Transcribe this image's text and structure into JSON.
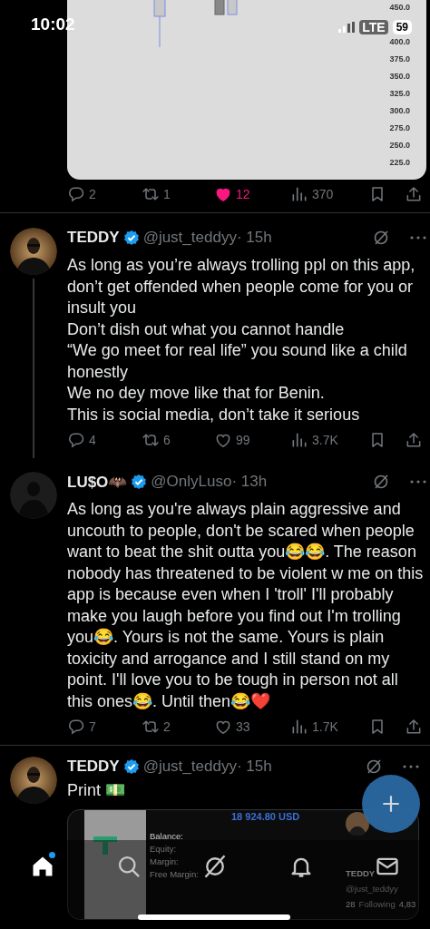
{
  "status_bar": {
    "time": "10:02",
    "network": "LTE",
    "battery": "59"
  },
  "tweets": [
    {
      "media": {
        "kind": "chart",
        "axis_labels": [
          "450.0",
          "400.0",
          "375.0",
          "350.0",
          "325.0",
          "300.0",
          "275.0",
          "250.0",
          "225.0"
        ]
      },
      "actions": [
        {
          "kind": "reply",
          "count": "2"
        },
        {
          "kind": "repost",
          "count": "1"
        },
        {
          "kind": "like",
          "count": "12",
          "liked": true
        },
        {
          "kind": "views",
          "count": "370"
        }
      ]
    },
    {
      "author": {
        "name": "TEDDY",
        "verified": true,
        "handle": "@just_teddyy",
        "time": "· 15h"
      },
      "thread_below": true,
      "text": "As long as you’re always trolling ppl on this app, don’t get offended when people come for you or insult you\nDon’t dish out what you cannot handle\n“We go meet for real life” you sound like a child honestly\nWe no dey move like that for Benin.\nThis is social media, don’t take it serious",
      "actions": [
        {
          "kind": "reply",
          "count": "4"
        },
        {
          "kind": "repost",
          "count": "6"
        },
        {
          "kind": "like",
          "count": "99",
          "liked": false
        },
        {
          "kind": "views",
          "count": "3.7K"
        }
      ]
    },
    {
      "author": {
        "name": "LU$O🦇",
        "verified": true,
        "handle": "@OnlyLuso",
        "time": "· 13h",
        "avatar": {
          "kind": "silhouette"
        }
      },
      "thread_below": false,
      "text": "As long as you're always plain aggressive and uncouth to people, don't be scared when people want to beat the shit outta you😂😂. The reason nobody has threatened to be violent w me on this app is because even when I 'troll' I'll probably make you laugh before you find out I'm trolling you😂. Yours is not the same. Yours is plain toxicity and arrogance and I still stand on my point. I'll love you to be tough in person not all this ones😂. Until then😂❤️",
      "actions": [
        {
          "kind": "reply",
          "count": "7"
        },
        {
          "kind": "repost",
          "count": "2"
        },
        {
          "kind": "like",
          "count": "33",
          "liked": false
        },
        {
          "kind": "views",
          "count": "1.7K"
        }
      ]
    },
    {
      "author": {
        "name": "TEDDY",
        "verified": true,
        "handle": "@just_teddyy",
        "time": "· 15h"
      },
      "thread_below": false,
      "text": "Print 💵",
      "media": {
        "kind": "screenshot",
        "amount": "18 924.80 USD",
        "labels": [
          "Balance:",
          "Equity:",
          "Margin:",
          "Free Margin:"
        ],
        "profile": {
          "name": "TEDDY",
          "handle": "@just_teddyy",
          "following_count": "28",
          "following_label": "Following",
          "followers": "4,83"
        }
      }
    }
  ],
  "fab": {
    "kind": "compose"
  },
  "nav": [
    {
      "kind": "home",
      "selected": true,
      "badge": true
    },
    {
      "kind": "search",
      "selected": false,
      "badge": false
    },
    {
      "kind": "grok",
      "selected": false,
      "badge": false
    },
    {
      "kind": "notifications",
      "selected": false,
      "badge": false
    },
    {
      "kind": "messages",
      "selected": false,
      "badge": false
    }
  ]
}
